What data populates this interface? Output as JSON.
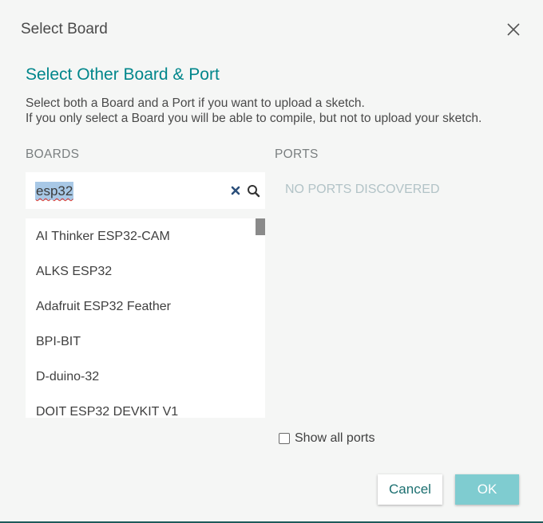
{
  "dialog": {
    "title": "Select Board",
    "heading": "Select Other Board & Port",
    "description_line1": "Select both a Board and a Port if you want to upload a sketch.",
    "description_line2": "If you only select a Board you will be able to compile, but not to upload your sketch."
  },
  "boards": {
    "label": "BOARDS",
    "search_value": "esp32",
    "items": [
      "AI Thinker ESP32-CAM",
      "ALKS ESP32",
      "Adafruit ESP32 Feather",
      "BPI-BIT",
      "D-duino-32",
      "DOIT ESP32 DEVKIT V1"
    ]
  },
  "ports": {
    "label": "PORTS",
    "empty_message": "NO PORTS DISCOVERED",
    "show_all_label": "Show all ports",
    "show_all_checked": false
  },
  "buttons": {
    "cancel": "Cancel",
    "ok": "OK"
  },
  "icons": {
    "close": "close-icon",
    "clear": "clear-icon",
    "search": "search-icon"
  },
  "colors": {
    "accent": "#00868b",
    "ok_button": "#7fccd0",
    "selection": "#a8c8e6",
    "muted_text": "#b2c3c7"
  }
}
